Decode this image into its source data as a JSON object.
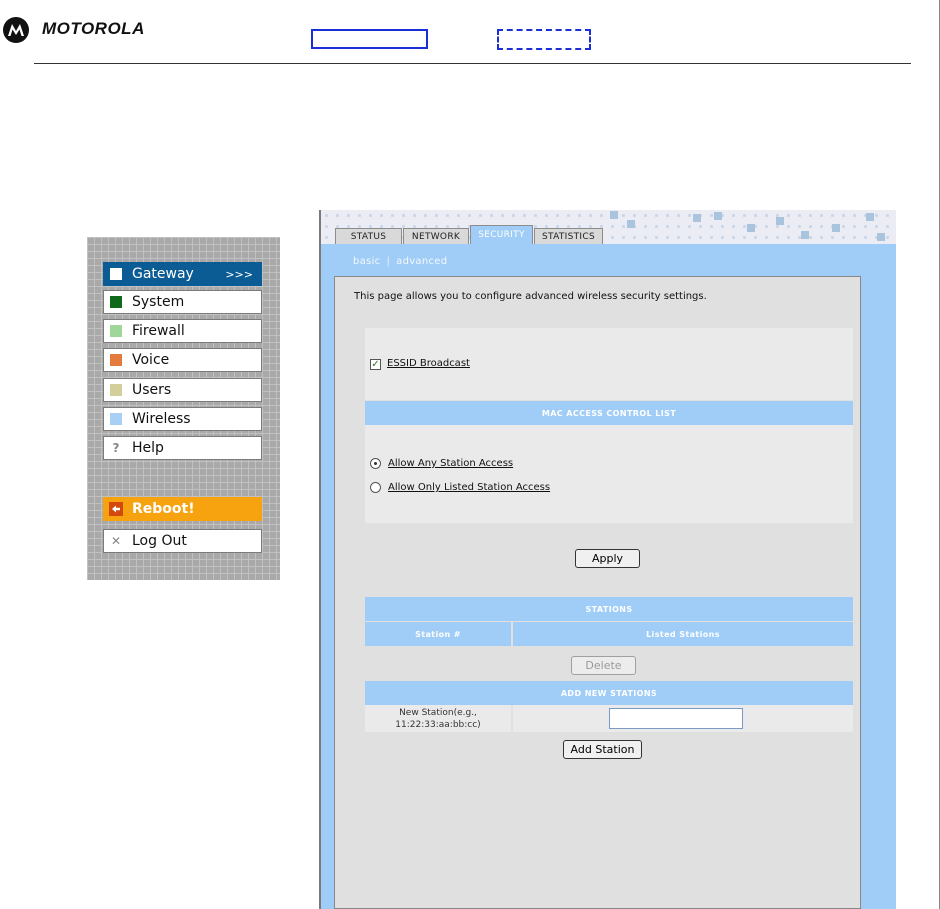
{
  "brand": {
    "name": "MOTOROLA",
    "logo_icon": "motorola-batwing-icon"
  },
  "nav": {
    "items": [
      {
        "label": "Gateway",
        "icon": "white-square-icon",
        "active": true,
        "arrow": ">>>"
      },
      {
        "label": "System",
        "icon": "dark-green-square-icon",
        "color": "#0e6a1a"
      },
      {
        "label": "Firewall",
        "icon": "light-green-square-icon",
        "color": "#9fd69a"
      },
      {
        "label": "Voice",
        "icon": "orange-square-icon",
        "color": "#e57a3d"
      },
      {
        "label": "Users",
        "icon": "khaki-square-icon",
        "color": "#d3cf9a"
      },
      {
        "label": "Wireless",
        "icon": "light-blue-square-icon",
        "color": "#a8d0f5"
      },
      {
        "label": "Help",
        "icon": "question-mark-icon",
        "glyph": "?"
      }
    ],
    "reboot": {
      "label": "Reboot!",
      "icon": "back-arrow-icon",
      "color": "#f7a20f"
    },
    "logout": {
      "label": "Log Out",
      "icon": "x-icon",
      "glyph": "✕"
    }
  },
  "tabs": [
    {
      "label": "STATUS",
      "active": false
    },
    {
      "label": "NETWORK",
      "active": false
    },
    {
      "label": "SECURITY",
      "active": true
    },
    {
      "label": "STATISTICS",
      "active": false
    }
  ],
  "subnav": {
    "basic": "basic",
    "separator": "|",
    "advanced": "advanced"
  },
  "page": {
    "intro": "This page allows you to configure advanced wireless security settings.",
    "essid_broadcast": {
      "label": "ESSID Broadcast",
      "checked": true
    },
    "mac_acl": {
      "title": "MAC ACCESS CONTROL LIST",
      "options": [
        {
          "label": "Allow Any Station Access",
          "selected": true
        },
        {
          "label": "Allow Only Listed Station Access",
          "selected": false
        }
      ]
    },
    "apply_label": "Apply",
    "stations": {
      "title": "STATIONS",
      "columns": [
        "Station #",
        "Listed Stations"
      ]
    },
    "delete_label": "Delete",
    "add_new": {
      "title": "ADD NEW STATIONS",
      "field_label_line1": "New Station(e.g.,",
      "field_label_line2": "11:22:33:aa:bb:cc)",
      "value": "",
      "button_label": "Add Station"
    }
  },
  "colors": {
    "accent": "#9fcdf7",
    "active_nav": "#0b5c94",
    "reboot": "#f7a20f"
  }
}
